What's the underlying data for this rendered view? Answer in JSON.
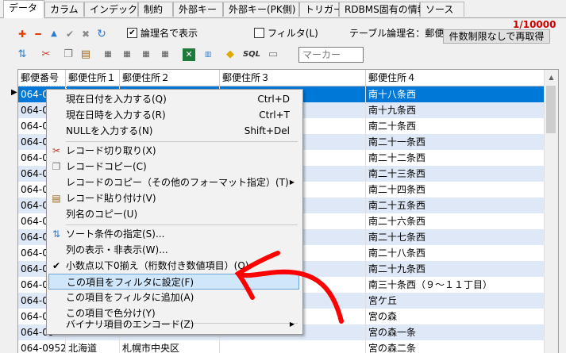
{
  "tabs": [
    "データ",
    "カラム",
    "インデックス",
    "制約",
    "外部キー",
    "外部キー(PK側)",
    "トリガー",
    "RDBMS固有の情報",
    "ソース"
  ],
  "toolbar": {
    "logical_name_check": "論理名で表示",
    "logical_name_checked": "✔",
    "filter_check": "フィルタ(L)",
    "table_logical_name": "テーブル論理名：郵便番号データ",
    "count": "1/10000",
    "count_color": "#cc0000",
    "refetch_button": "件数制限なしで再取得",
    "marker_placeholder": "マーカー",
    "sql_label": "SQL"
  },
  "grid": {
    "columns": [
      "郵便番号",
      "郵便住所１",
      "郵便住所２",
      "郵便住所３",
      "郵便住所４"
    ],
    "rows": [
      [
        "064-0",
        "",
        "",
        "",
        "南十八条西"
      ],
      [
        "064-09",
        "",
        "",
        "",
        "南十九条西"
      ],
      [
        "064-09",
        "",
        "",
        "",
        "南二十条西"
      ],
      [
        "064-09",
        "",
        "",
        "",
        "南二十一条西"
      ],
      [
        "064-09",
        "",
        "",
        "",
        "南二十二条西"
      ],
      [
        "064-09",
        "",
        "",
        "",
        "南二十三条西"
      ],
      [
        "064-09",
        "",
        "",
        "",
        "南二十四条西"
      ],
      [
        "064-09",
        "",
        "",
        "",
        "南二十五条西"
      ],
      [
        "064-09",
        "",
        "",
        "",
        "南二十六条西"
      ],
      [
        "064-09",
        "",
        "",
        "",
        "南二十七条西"
      ],
      [
        "064-09",
        "",
        "",
        "",
        "南二十八条西"
      ],
      [
        "064-09",
        "",
        "",
        "",
        "南二十九条西"
      ],
      [
        "064-09",
        "",
        "",
        "",
        "南三十条西（９～１１丁目）"
      ],
      [
        "064-09",
        "",
        "",
        "",
        "宮ケ丘"
      ],
      [
        "064-09",
        "",
        "",
        "",
        "宮の森"
      ],
      [
        "064-09",
        "",
        "",
        "",
        "宮の森一条"
      ],
      [
        "064-0952",
        "北海道",
        "札幌市中央区",
        "",
        "宮の森二条"
      ]
    ]
  },
  "menu": {
    "items": [
      {
        "label": "現在日付を入力する(Q)",
        "shortcut": "Ctrl+D"
      },
      {
        "label": "現在日時を入力する(R)",
        "shortcut": "Ctrl+T"
      },
      {
        "label": "NULLを入力する(N)",
        "shortcut": "Shift+Del"
      },
      {
        "label": "レコード切り取り(X)",
        "shortcut": ""
      },
      {
        "label": "レコードコピー(C)",
        "shortcut": ""
      },
      {
        "label": "レコードのコピー（その他のフォーマット指定）(T)",
        "shortcut": ""
      },
      {
        "label": "レコード貼り付け(V)",
        "shortcut": ""
      },
      {
        "label": "列名のコピー(U)",
        "shortcut": ""
      },
      {
        "label": "ソート条件の指定(S)...",
        "shortcut": ""
      },
      {
        "label": "列の表示・非表示(W)...",
        "shortcut": ""
      },
      {
        "label": "小数点以下0揃え（桁数付き数値項目）(O)",
        "shortcut": ""
      },
      {
        "label": "この項目をフィルタに設定(F)",
        "shortcut": ""
      },
      {
        "label": "この項目をフィルタに追加(A)",
        "shortcut": ""
      },
      {
        "label": "この項目で色分け(Y)",
        "shortcut": ""
      },
      {
        "label": "バイナリ項目のエンコード(Z)",
        "shortcut": ""
      }
    ]
  },
  "colors": {
    "selection": "#0078d7",
    "alt_row": "#dfe8f6",
    "menu_highlight": "#d0e6fa",
    "annotation": "#ff0000"
  }
}
